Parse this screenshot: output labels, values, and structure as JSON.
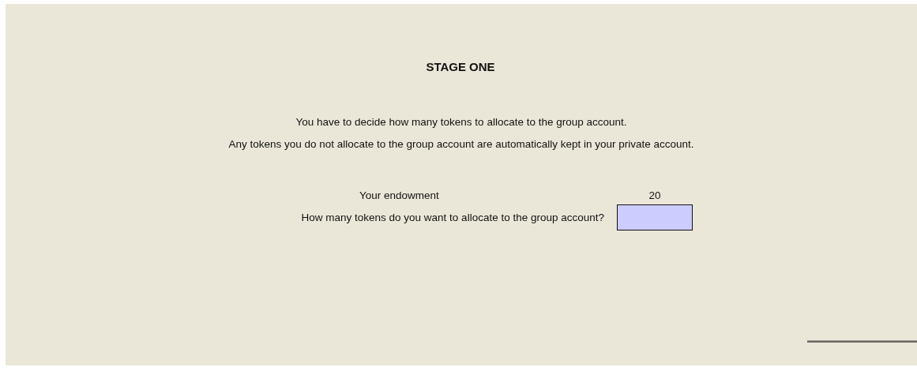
{
  "title": "STAGE ONE",
  "instructions": [
    "You have to decide how many tokens to allocate to the group account.",
    "Any tokens you do not allocate to the group account are automatically kept in your private account."
  ],
  "endowment": {
    "label": "Your endowment",
    "value": "20"
  },
  "allocation": {
    "label": "How many tokens do you want to allocate to the group account?"
  }
}
